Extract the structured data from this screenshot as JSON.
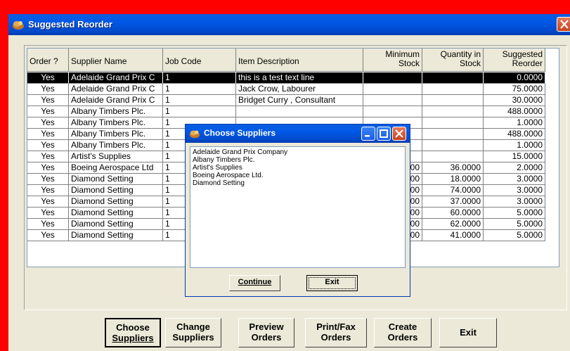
{
  "window": {
    "title": "Suggested Reorder"
  },
  "grid": {
    "headers": {
      "order": "Order ?",
      "supplier": "Supplier Name",
      "job": "Job Code",
      "item": "Item Description",
      "min1": "Minimum",
      "min2": "Stock",
      "qty1": "Quantity in",
      "qty2": "Stock",
      "sug1": "Suggested",
      "sug2": "Reorder"
    },
    "rows": [
      {
        "order": "Yes",
        "supplier": "Adelaide Grand Prix C",
        "job": "1",
        "item": "this is a test text line",
        "min": "",
        "qty": "",
        "sug": "0.0000"
      },
      {
        "order": "Yes",
        "supplier": "Adelaide Grand Prix C",
        "job": "1",
        "item": "Jack Crow, Labourer",
        "min": "",
        "qty": "",
        "sug": "75.0000"
      },
      {
        "order": "Yes",
        "supplier": "Adelaide Grand Prix C",
        "job": "1",
        "item": "Bridget Curry , Consultant",
        "min": "",
        "qty": "",
        "sug": "30.0000"
      },
      {
        "order": "Yes",
        "supplier": "Albany Timbers Plc.",
        "job": "1",
        "item": "",
        "min": "",
        "qty": "",
        "sug": "488.0000"
      },
      {
        "order": "Yes",
        "supplier": "Albany Timbers Plc.",
        "job": "1",
        "item": "",
        "min": "",
        "qty": "",
        "sug": "1.0000"
      },
      {
        "order": "Yes",
        "supplier": "Albany Timbers Plc.",
        "job": "1",
        "item": "",
        "min": "",
        "qty": "",
        "sug": "488.0000"
      },
      {
        "order": "Yes",
        "supplier": "Albany Timbers Plc.",
        "job": "1",
        "item": "",
        "min": "",
        "qty": "",
        "sug": "1.0000"
      },
      {
        "order": "Yes",
        "supplier": "Artist's Supplies",
        "job": "1",
        "item": "",
        "min": "",
        "qty": "",
        "sug": "15.0000"
      },
      {
        "order": "Yes",
        "supplier": "Boeing Aerospace Ltd",
        "job": "1",
        "item": "",
        "min": "000",
        "qty": "36.0000",
        "sug": "2.0000"
      },
      {
        "order": "Yes",
        "supplier": "Diamond Setting",
        "job": "1",
        "item": "",
        "min": "000",
        "qty": "18.0000",
        "sug": "3.0000"
      },
      {
        "order": "Yes",
        "supplier": "Diamond Setting",
        "job": "1",
        "item": "",
        "min": "000",
        "qty": "74.0000",
        "sug": "3.0000"
      },
      {
        "order": "Yes",
        "supplier": "Diamond Setting",
        "job": "1",
        "item": "",
        "min": "000",
        "qty": "37.0000",
        "sug": "3.0000"
      },
      {
        "order": "Yes",
        "supplier": "Diamond Setting",
        "job": "1",
        "item": "",
        "min": "000",
        "qty": "60.0000",
        "sug": "5.0000"
      },
      {
        "order": "Yes",
        "supplier": "Diamond Setting",
        "job": "1",
        "item": "",
        "min": "000",
        "qty": "62.0000",
        "sug": "5.0000"
      },
      {
        "order": "Yes",
        "supplier": "Diamond Setting",
        "job": "1",
        "item": "",
        "min": "000",
        "qty": "41.0000",
        "sug": "5.0000"
      }
    ]
  },
  "buttons": {
    "choose": {
      "l1": "Choose",
      "l2": "Suppliers"
    },
    "change": {
      "l1": "Change",
      "l2": "Suppliers"
    },
    "preview": {
      "l1": "Preview",
      "l2": "Orders"
    },
    "print": {
      "l1": "Print/Fax",
      "l2": "Orders"
    },
    "create": {
      "l1": "Create",
      "l2": "Orders"
    },
    "exit": {
      "l1": "Exit"
    }
  },
  "dialog": {
    "title": "Choose Suppliers",
    "suppliers": [
      "Adelaide Grand Prix Company",
      "Albany Timbers Plc.",
      "Artist's Supplies",
      "Boeing Aerospace Ltd.",
      "Diamond Setting"
    ],
    "continue_label": "Continue",
    "exit_label": "Exit"
  },
  "colors": {
    "titlebar": "#0058e6",
    "window_face": "#ece9d8",
    "selected_row": "#000000",
    "outer_background": "#ff0000"
  }
}
